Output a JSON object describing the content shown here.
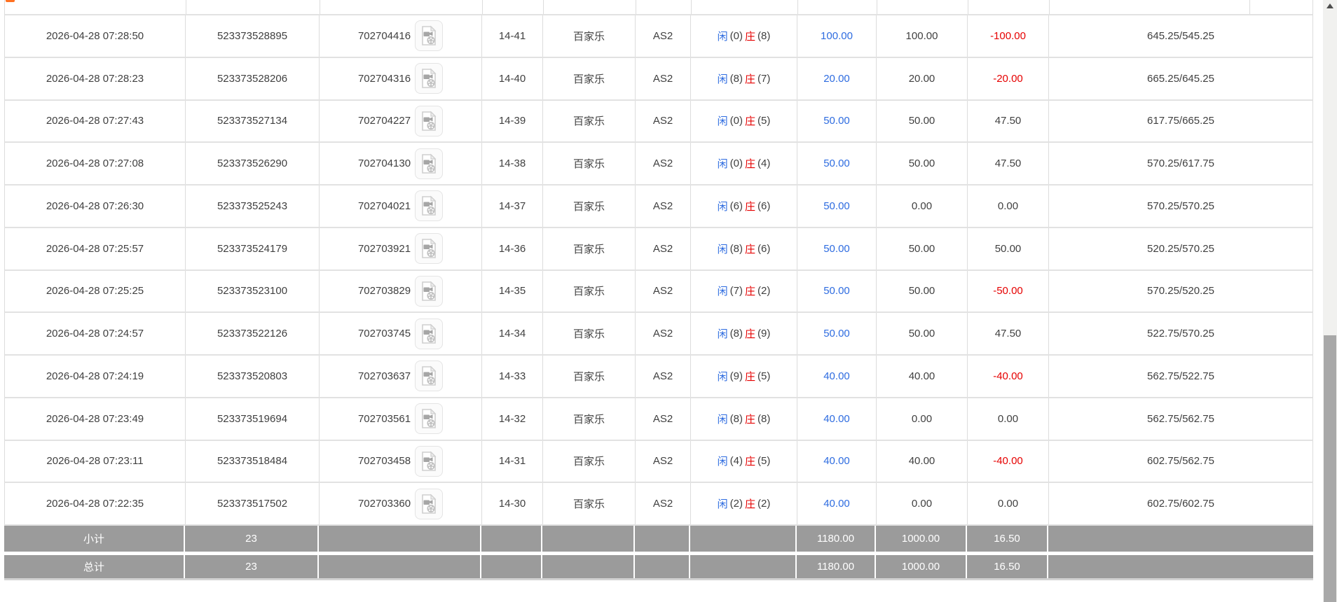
{
  "colors": {
    "accent_blue": "#2e6ce0",
    "negative_red": "#e60000",
    "summary_bg": "#9b9b9b",
    "border_gray": "#dcdcdc",
    "scroll_thumb": "#a8a8a8",
    "top_marker_orange": "#ff7122"
  },
  "table": {
    "result_labels": {
      "player": "闲",
      "banker": "庄"
    },
    "icons": {
      "video": "video-file-icon"
    },
    "rows": [
      {
        "time": "2026-04-28 07:28:50",
        "bet_id": "523373528895",
        "game_no": "702704416",
        "round": "14-41",
        "game": "百家乐",
        "table": "AS2",
        "player": "0",
        "banker": "8",
        "bet": "100.00",
        "valid": "100.00",
        "win_loss": "-100.00",
        "balance": "645.25/545.25"
      },
      {
        "time": "2026-04-28 07:28:23",
        "bet_id": "523373528206",
        "game_no": "702704316",
        "round": "14-40",
        "game": "百家乐",
        "table": "AS2",
        "player": "8",
        "banker": "7",
        "bet": "20.00",
        "valid": "20.00",
        "win_loss": "-20.00",
        "balance": "665.25/645.25"
      },
      {
        "time": "2026-04-28 07:27:43",
        "bet_id": "523373527134",
        "game_no": "702704227",
        "round": "14-39",
        "game": "百家乐",
        "table": "AS2",
        "player": "0",
        "banker": "5",
        "bet": "50.00",
        "valid": "50.00",
        "win_loss": "47.50",
        "balance": "617.75/665.25"
      },
      {
        "time": "2026-04-28 07:27:08",
        "bet_id": "523373526290",
        "game_no": "702704130",
        "round": "14-38",
        "game": "百家乐",
        "table": "AS2",
        "player": "0",
        "banker": "4",
        "bet": "50.00",
        "valid": "50.00",
        "win_loss": "47.50",
        "balance": "570.25/617.75"
      },
      {
        "time": "2026-04-28 07:26:30",
        "bet_id": "523373525243",
        "game_no": "702704021",
        "round": "14-37",
        "game": "百家乐",
        "table": "AS2",
        "player": "6",
        "banker": "6",
        "bet": "50.00",
        "valid": "0.00",
        "win_loss": "0.00",
        "balance": "570.25/570.25"
      },
      {
        "time": "2026-04-28 07:25:57",
        "bet_id": "523373524179",
        "game_no": "702703921",
        "round": "14-36",
        "game": "百家乐",
        "table": "AS2",
        "player": "8",
        "banker": "6",
        "bet": "50.00",
        "valid": "50.00",
        "win_loss": "50.00",
        "balance": "520.25/570.25"
      },
      {
        "time": "2026-04-28 07:25:25",
        "bet_id": "523373523100",
        "game_no": "702703829",
        "round": "14-35",
        "game": "百家乐",
        "table": "AS2",
        "player": "7",
        "banker": "2",
        "bet": "50.00",
        "valid": "50.00",
        "win_loss": "-50.00",
        "balance": "570.25/520.25"
      },
      {
        "time": "2026-04-28 07:24:57",
        "bet_id": "523373522126",
        "game_no": "702703745",
        "round": "14-34",
        "game": "百家乐",
        "table": "AS2",
        "player": "8",
        "banker": "9",
        "bet": "50.00",
        "valid": "50.00",
        "win_loss": "47.50",
        "balance": "522.75/570.25"
      },
      {
        "time": "2026-04-28 07:24:19",
        "bet_id": "523373520803",
        "game_no": "702703637",
        "round": "14-33",
        "game": "百家乐",
        "table": "AS2",
        "player": "9",
        "banker": "5",
        "bet": "40.00",
        "valid": "40.00",
        "win_loss": "-40.00",
        "balance": "562.75/522.75"
      },
      {
        "time": "2026-04-28 07:23:49",
        "bet_id": "523373519694",
        "game_no": "702703561",
        "round": "14-32",
        "game": "百家乐",
        "table": "AS2",
        "player": "8",
        "banker": "8",
        "bet": "40.00",
        "valid": "0.00",
        "win_loss": "0.00",
        "balance": "562.75/562.75"
      },
      {
        "time": "2026-04-28 07:23:11",
        "bet_id": "523373518484",
        "game_no": "702703458",
        "round": "14-31",
        "game": "百家乐",
        "table": "AS2",
        "player": "4",
        "banker": "5",
        "bet": "40.00",
        "valid": "40.00",
        "win_loss": "-40.00",
        "balance": "602.75/562.75"
      },
      {
        "time": "2026-04-28 07:22:35",
        "bet_id": "523373517502",
        "game_no": "702703360",
        "round": "14-30",
        "game": "百家乐",
        "table": "AS2",
        "player": "2",
        "banker": "2",
        "bet": "40.00",
        "valid": "0.00",
        "win_loss": "0.00",
        "balance": "602.75/602.75"
      }
    ],
    "subtotal": {
      "label": "小计",
      "count": "23",
      "bet": "1180.00",
      "valid": "1000.00",
      "win_loss": "16.50"
    },
    "total": {
      "label": "总计",
      "count": "23",
      "bet": "1180.00",
      "valid": "1000.00",
      "win_loss": "16.50"
    }
  }
}
